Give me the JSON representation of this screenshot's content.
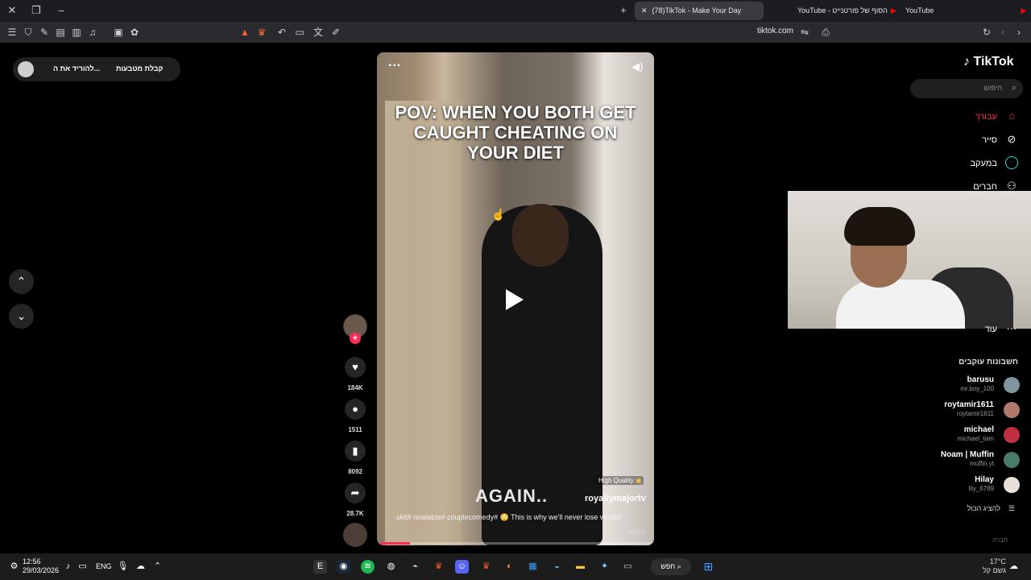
{
  "browser": {
    "tabs": [
      {
        "label": "(78)TikTok - Make Your Day",
        "active": true
      },
      {
        "label": "YouTube - הסוף של פורטנייט"
      },
      {
        "label": "YouTube"
      }
    ],
    "url": "tiktok.com",
    "new_tab": "+"
  },
  "promo": {
    "label1": "להוריד את ה...",
    "label2": "קבלת מטבעות"
  },
  "video": {
    "overlay_title": "POV: WHEN YOU BOTH GET CAUGHT CHEATING ON YOUR DIET",
    "caption_big": "AGAIN..",
    "quality_badge": "High Quality",
    "author": "royaltymajortv",
    "description": "skit# relatable# couplecomedy# 😳 This is why we'll never lose weight",
    "translate": "תרגום",
    "progress": 0.11
  },
  "actions": {
    "likes": "184K",
    "comments": "1511",
    "saves": "8092",
    "shares": "28.7K"
  },
  "sidebar": {
    "logo": "TikTok",
    "search_placeholder": "חיפוש",
    "nav": [
      {
        "label": "עבורך",
        "icon": "home-icon",
        "color": "#fe2c55"
      },
      {
        "label": "סייר",
        "icon": "compass-icon"
      },
      {
        "label": "במעקב",
        "icon": "following-icon"
      },
      {
        "label": "חברים",
        "icon": "friends-icon"
      }
    ],
    "more_label": "עוד",
    "following_heading": "חשבונות עוקבים",
    "accounts": [
      {
        "name": "barusu",
        "handle": "mr.boy_100"
      },
      {
        "name": "roytamir1611",
        "handle": "roytamir1611"
      },
      {
        "name": "michael",
        "handle": "michael_tam"
      },
      {
        "name": "Noam | Muffin",
        "handle": "muffin.yt"
      },
      {
        "name": "Hilay",
        "handle": "lily_6789"
      }
    ],
    "show_all": "להציג הכול",
    "footer_hint": "חברה"
  },
  "taskbar": {
    "time": "12:56",
    "date": "29/03/2026",
    "lang": "ENG",
    "search": "חפש",
    "temp": "17°C",
    "weather": "גשם קל"
  },
  "colors": {
    "accent": "#fe2c55",
    "tabbar": "#1c1d20",
    "toolbar": "#2a2b2f"
  }
}
